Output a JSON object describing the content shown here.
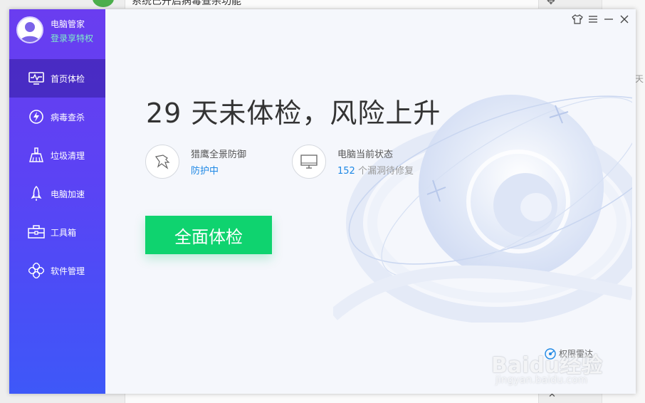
{
  "background": {
    "top_text": "系统已开启病毒查杀功能",
    "right_text": "天"
  },
  "user": {
    "name": "电脑管家",
    "login_text": "登录享特权"
  },
  "sidebar": {
    "items": [
      {
        "label": "首页体检",
        "icon": "monitor-pulse-icon",
        "active": true
      },
      {
        "label": "病毒查杀",
        "icon": "lightning-shield-icon",
        "active": false
      },
      {
        "label": "垃圾清理",
        "icon": "broom-icon",
        "active": false
      },
      {
        "label": "电脑加速",
        "icon": "rocket-icon",
        "active": false
      },
      {
        "label": "工具箱",
        "icon": "toolbox-icon",
        "active": false
      },
      {
        "label": "软件管理",
        "icon": "software-grid-icon",
        "active": false
      }
    ]
  },
  "window_controls": [
    "skin-icon",
    "menu-icon",
    "minimize-icon",
    "close-icon"
  ],
  "main": {
    "headline": "29 天未体检，风险上升",
    "status": [
      {
        "title": "猎鹰全景防御",
        "value": "防护中",
        "icon": "falcon-icon"
      },
      {
        "title": "电脑当前状态",
        "value_number": "152",
        "value_suffix": " 个漏洞待修复",
        "icon": "monitor-icon"
      }
    ],
    "scan_button": "全面体检",
    "footer_link": "权限雷达"
  },
  "watermark": {
    "main": "Baidu经验",
    "sub": "jingyan.baidu.com"
  },
  "colors": {
    "sidebar_top": "#6a3df0",
    "sidebar_bottom": "#3e58f8",
    "accent_green": "#0fd36f",
    "link_blue": "#1e88e5",
    "login_green": "#7ff0c8"
  }
}
